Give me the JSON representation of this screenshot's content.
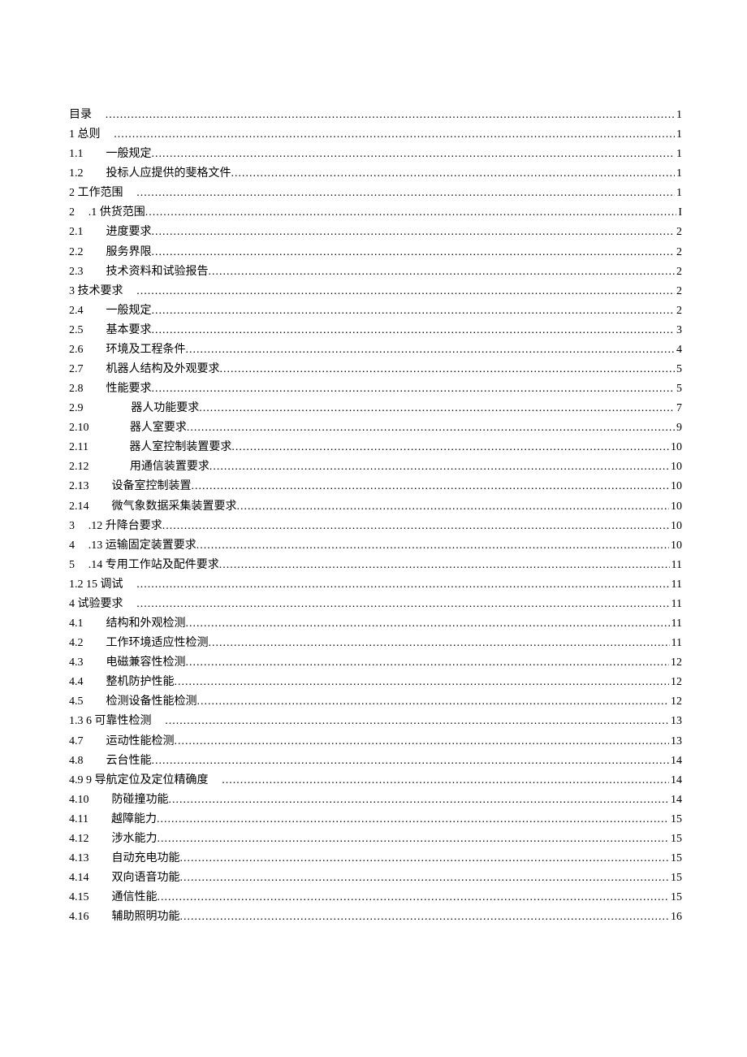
{
  "toc": [
    {
      "label": "目录",
      "indent_em": 0,
      "gap_em": 0.5,
      "title": "",
      "page": "1"
    },
    {
      "label": "1 总则",
      "indent_em": 0,
      "gap_em": 0.5,
      "title": "",
      "page": "1"
    },
    {
      "label": "1.1",
      "indent_em": 0,
      "gap_em": 2.0,
      "title": "一般规定",
      "page": "1"
    },
    {
      "label": "1.2",
      "indent_em": 0,
      "gap_em": 2.0,
      "title": "投标人应提供的斐格文件",
      "page": "1"
    },
    {
      "label": "2 工作范围",
      "indent_em": 0,
      "gap_em": 0.5,
      "title": "",
      "page": "1"
    },
    {
      "label": "2",
      "indent_em": 0,
      "gap_em": 1.2,
      "title": ".1 供货范围",
      "page": "I"
    },
    {
      "label": "2.1",
      "indent_em": 0,
      "gap_em": 2.0,
      "title": "进度要求",
      "page": "2"
    },
    {
      "label": "2.2",
      "indent_em": 0,
      "gap_em": 2.0,
      "title": "服务界限",
      "page": "2"
    },
    {
      "label": "2.3",
      "indent_em": 0,
      "gap_em": 2.0,
      "title": "技术资料和试验报告",
      "page": "2"
    },
    {
      "label": "3 技术要求",
      "indent_em": 0,
      "gap_em": 0.5,
      "title": "",
      "page": "2"
    },
    {
      "label": "2.4",
      "indent_em": 0,
      "gap_em": 2.0,
      "title": "一般规定",
      "page": "2"
    },
    {
      "label": "2.5",
      "indent_em": 0,
      "gap_em": 2.0,
      "title": "基本要求",
      "page": "3"
    },
    {
      "label": "2.6",
      "indent_em": 0,
      "gap_em": 2.0,
      "title": "环境及工程条件",
      "page": "4"
    },
    {
      "label": "2.7",
      "indent_em": 0,
      "gap_em": 2.0,
      "title": "机器人结构及外观要求",
      "page": "5"
    },
    {
      "label": "2.8",
      "indent_em": 0,
      "gap_em": 2.0,
      "title": "性能要求",
      "page": "5"
    },
    {
      "label": "2.9",
      "indent_em": 0,
      "gap_em": 4.2,
      "title": "器人功能要求",
      "page": "7"
    },
    {
      "label": "2.10",
      "indent_em": 0,
      "gap_em": 3.6,
      "title": "器人室要求",
      "page": "9"
    },
    {
      "label": "2.11",
      "indent_em": 0,
      "gap_em": 3.6,
      "title": "器人室控制装置要求",
      "page": "10"
    },
    {
      "label": "2.12",
      "indent_em": 0,
      "gap_em": 3.6,
      "title": "用通信装置要求",
      "page": "10"
    },
    {
      "label": "2.13",
      "indent_em": 0,
      "gap_em": 2.0,
      "title": "设备室控制装置",
      "page": "10"
    },
    {
      "label": "2.14",
      "indent_em": 0,
      "gap_em": 2.0,
      "title": "微气象数据采集装置要求",
      "page": "10"
    },
    {
      "label": "3",
      "indent_em": 0,
      "gap_em": 1.2,
      "title": ".12 升降台要求",
      "page": "10"
    },
    {
      "label": "4",
      "indent_em": 0,
      "gap_em": 1.2,
      "title": ".13 运输固定装置要求",
      "page": "10"
    },
    {
      "label": "5",
      "indent_em": 0,
      "gap_em": 1.2,
      "title": ".14 专用工作站及配件要求",
      "page": "11"
    },
    {
      "label": "1.2 15 调试",
      "indent_em": 0,
      "gap_em": 0.3,
      "title": "",
      "page": "11"
    },
    {
      "label": "4 试验要求",
      "indent_em": 0,
      "gap_em": 0.5,
      "title": "",
      "page": "11"
    },
    {
      "label": "4.1",
      "indent_em": 0,
      "gap_em": 2.0,
      "title": "结构和外观检测",
      "page": "11"
    },
    {
      "label": "4.2",
      "indent_em": 0,
      "gap_em": 2.0,
      "title": "工作环境适应性检测",
      "page": "11"
    },
    {
      "label": "4.3",
      "indent_em": 0,
      "gap_em": 2.0,
      "title": "电磁兼容性检测",
      "page": "12"
    },
    {
      "label": "4.4",
      "indent_em": 0,
      "gap_em": 2.0,
      "title": "整机防护性能",
      "page": "12"
    },
    {
      "label": "4.5",
      "indent_em": 0,
      "gap_em": 2.0,
      "title": "检测设备性能检测",
      "page": "12"
    },
    {
      "label": "1.3 6 可靠性检测",
      "indent_em": 0,
      "gap_em": 0.3,
      "title": "",
      "page": "13"
    },
    {
      "label": "4.7",
      "indent_em": 0,
      "gap_em": 2.0,
      "title": "运动性能检测",
      "page": "13"
    },
    {
      "label": "4.8",
      "indent_em": 0,
      "gap_em": 2.0,
      "title": "云台性能",
      "page": "14"
    },
    {
      "label": "4.9 9 导航定位及定位精确度",
      "indent_em": 0,
      "gap_em": 0.3,
      "title": "",
      "page": "14"
    },
    {
      "label": "4.10",
      "indent_em": 0,
      "gap_em": 2.0,
      "title": "防碰撞功能",
      "page": "14"
    },
    {
      "label": "4.11",
      "indent_em": 0,
      "gap_em": 2.0,
      "title": "越障能力",
      "page": "15"
    },
    {
      "label": "4.12",
      "indent_em": 0,
      "gap_em": 2.0,
      "title": "涉水能力",
      "page": "15"
    },
    {
      "label": "4.13",
      "indent_em": 0,
      "gap_em": 2.0,
      "title": "自动充电功能",
      "page": "15"
    },
    {
      "label": "4.14",
      "indent_em": 0,
      "gap_em": 2.0,
      "title": "双向语音功能",
      "page": "15"
    },
    {
      "label": "4.15",
      "indent_em": 0,
      "gap_em": 2.0,
      "title": "通信性能",
      "page": "15"
    },
    {
      "label": "4.16",
      "indent_em": 0,
      "gap_em": 2.0,
      "title": "辅助照明功能",
      "page": "16"
    }
  ]
}
